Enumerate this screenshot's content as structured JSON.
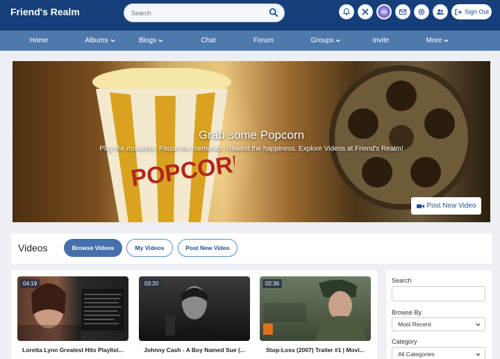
{
  "header": {
    "logo": "Friend's Realm",
    "search_placeholder": "Search",
    "icons": [
      "bell-icon",
      "tools-icon",
      "avatar",
      "mail-icon",
      "gear-icon",
      "users-icon"
    ],
    "signout_label": "Sign Out"
  },
  "nav": {
    "items": [
      {
        "label": "Home",
        "dropdown": false
      },
      {
        "label": "Albums",
        "dropdown": true
      },
      {
        "label": "Blogs",
        "dropdown": true
      },
      {
        "label": "Chat",
        "dropdown": false
      },
      {
        "label": "Forum",
        "dropdown": false
      },
      {
        "label": "Groups",
        "dropdown": true
      },
      {
        "label": "Invite",
        "dropdown": false
      },
      {
        "label": "More",
        "dropdown": true
      }
    ]
  },
  "banner": {
    "title": "Grab some Popcorn",
    "subtitle": "Play the moments. Pause the memories. Rewind the happiness. Explore Videos at Friend's Realm!",
    "button_label": "Post New Video"
  },
  "videos": {
    "heading": "Videos",
    "tabs": [
      "Browse Videos",
      "My Videos",
      "Post New Video"
    ],
    "cards": [
      {
        "duration": "04:19",
        "title": "Loretta Lynn Greatest Hits Playlist..."
      },
      {
        "duration": "03:20",
        "title": "Johnny Cash - A Boy Named Sue (..."
      },
      {
        "duration": "02:36",
        "title": "Stop-Loss (2007) Trailer #1 | Movi..."
      }
    ]
  },
  "sidebar": {
    "search_label": "Search",
    "browse_label": "Browse By",
    "browse_value": "Most Recent",
    "category_label": "Category",
    "category_value": "All Categories"
  },
  "colors": {
    "header_bg": "#153e7a",
    "nav_bg": "#4f79ad",
    "accent": "#4570ad"
  }
}
